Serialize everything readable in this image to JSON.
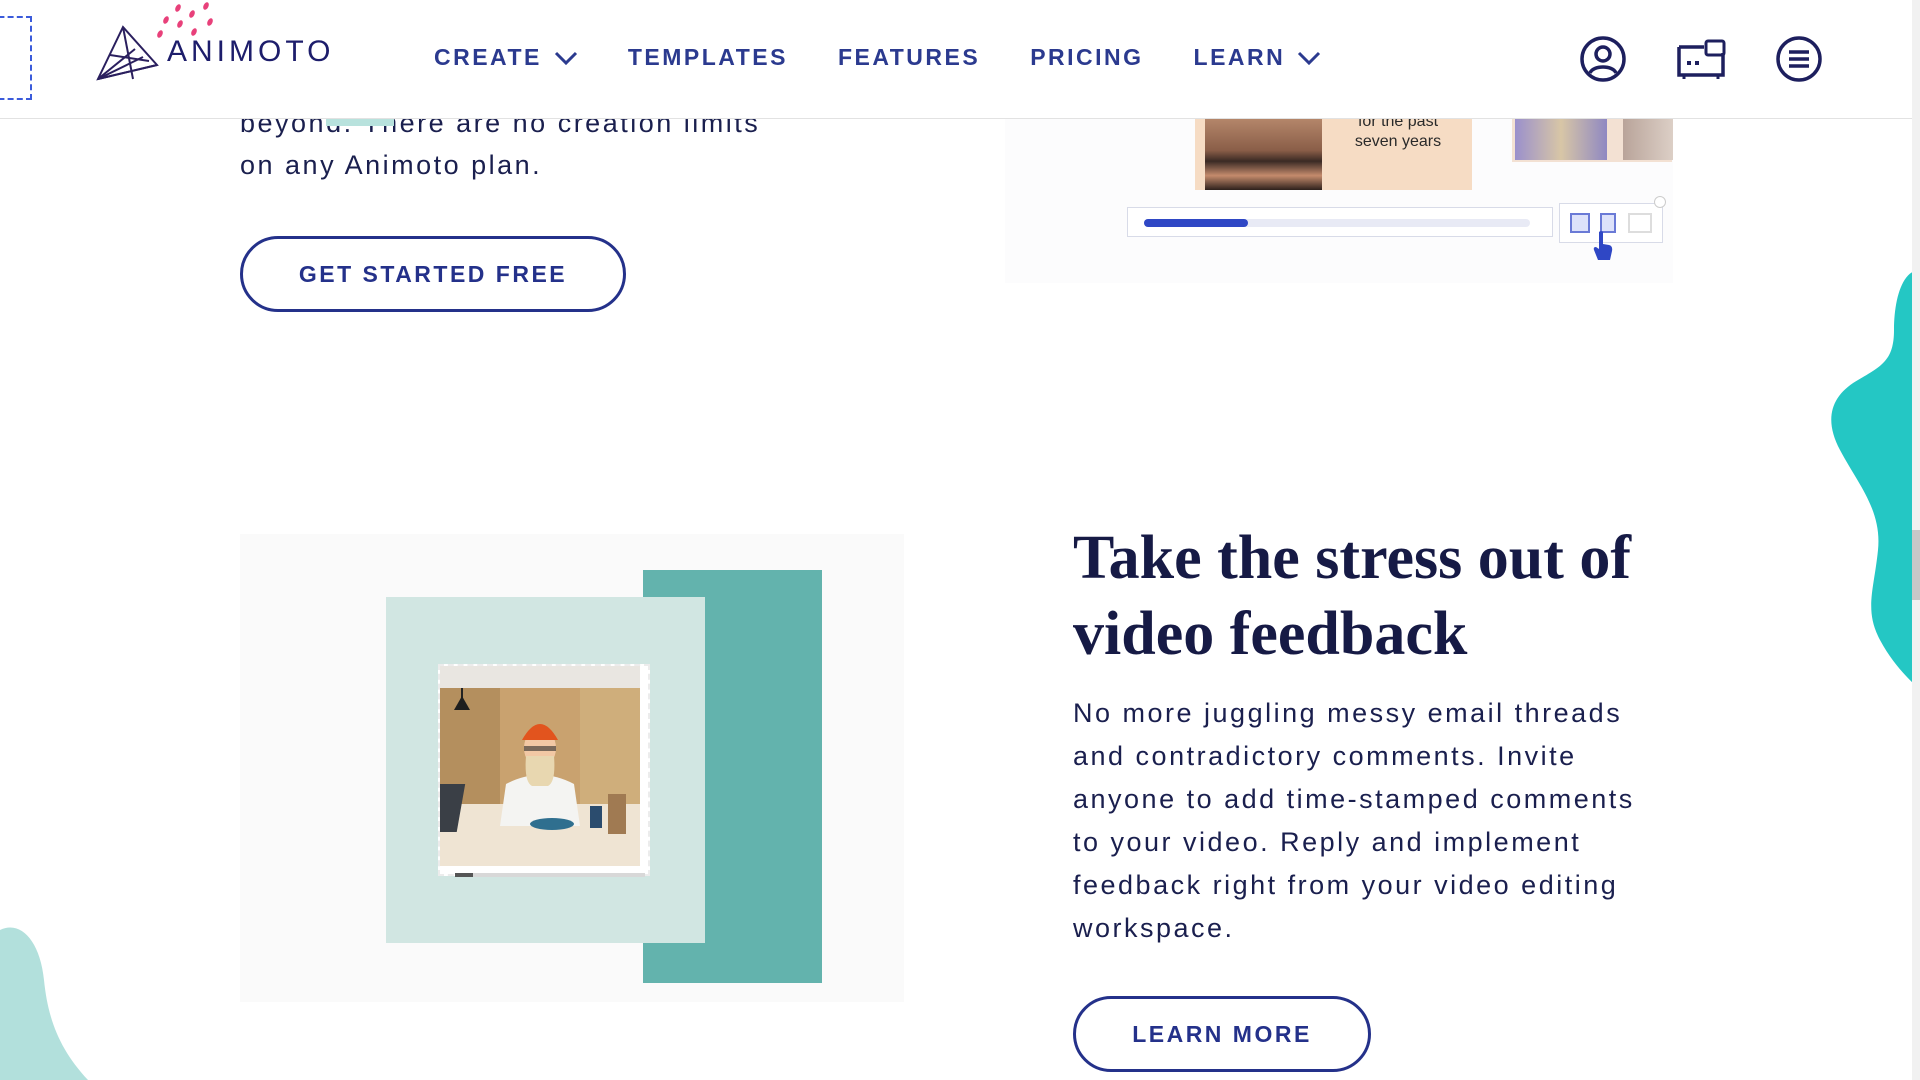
{
  "brand": {
    "name": "ANIMOTO"
  },
  "nav": {
    "items": [
      {
        "label": "CREATE",
        "has_dropdown": true
      },
      {
        "label": "TEMPLATES",
        "has_dropdown": false
      },
      {
        "label": "FEATURES",
        "has_dropdown": false
      },
      {
        "label": "PRICING",
        "has_dropdown": false
      },
      {
        "label": "LEARN",
        "has_dropdown": true
      }
    ],
    "icons": [
      "account-icon",
      "video-library-icon",
      "menu-icon"
    ]
  },
  "intro": {
    "text_line1": "beyond. There are no creation limits",
    "text_line2": "on any Animoto plan.",
    "cta_label": "GET STARTED FREE"
  },
  "preview": {
    "caption_line1": "for the past",
    "caption_line2": "seven years",
    "timeline_progress": 0.27
  },
  "feature": {
    "headline_line1": "Take the stress out of",
    "headline_line2": "video feedback",
    "body_lines": [
      "No more juggling messy email threads",
      "and contradictory comments. Invite",
      "anyone to add time-stamped comments",
      "to your video. Reply and implement",
      "feedback right from your video editing",
      "workspace."
    ],
    "cta_label": "LEARN MORE"
  },
  "colors": {
    "brand_navy": "#24318a",
    "teal": "#63b3ad",
    "mint": "#d1e6e2",
    "accent_pink": "#e8407a",
    "blob_teal": "#24c7c4"
  }
}
